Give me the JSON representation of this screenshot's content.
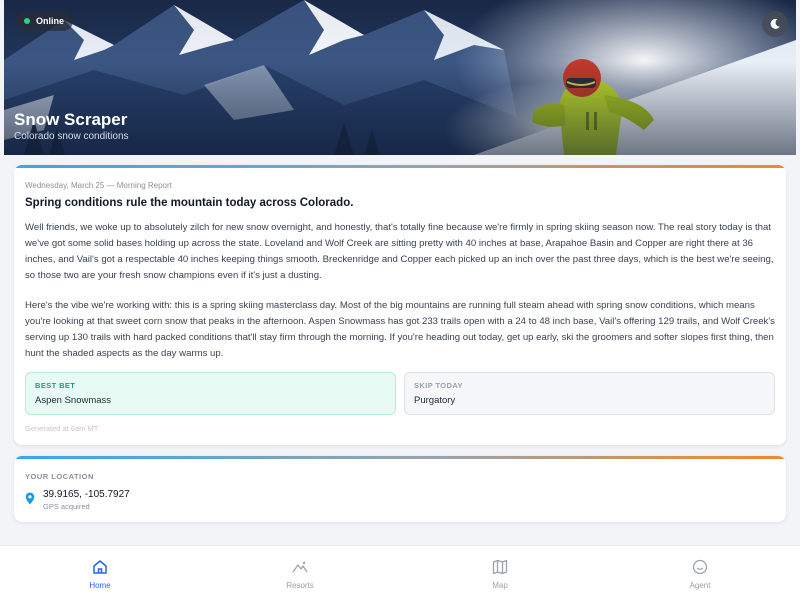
{
  "hero": {
    "status": "Online",
    "title": "Snow Scraper",
    "subtitle": "Colorado snow conditions"
  },
  "report": {
    "date": "Wednesday, March 25 — Morning Report",
    "headline": "Spring conditions rule the mountain today across Colorado.",
    "paragraphs": [
      "Well friends, we woke up to absolutely zilch for new snow overnight, and honestly, that's totally fine because we're firmly in spring skiing season now. The real story today is that we've got some solid bases holding up across the state. Loveland and Wolf Creek are sitting pretty with 40 inches at base, Arapahoe Basin and Copper are right there at 36 inches, and Vail's got a respectable 40 inches keeping things smooth. Breckenridge and Copper each picked up an inch over the past three days, which is the best we're seeing, so those two are your fresh snow champions even if it's just a dusting.",
      "Here's the vibe we're working with: this is a spring skiing masterclass day. Most of the big mountains are running full steam ahead with spring snow conditions, which means you're looking at that sweet corn snow that peaks in the afternoon. Aspen Snowmass has got 233 trails open with a 24 to 48 inch base, Vail's offering 129 trails, and Wolf Creek's serving up 130 trails with hard packed conditions that'll stay firm through the morning. If you're heading out today, get up early, ski the groomers and softer slopes first thing, then hunt the shaded aspects as the day warms up."
    ],
    "best_bet_label": "BEST BET",
    "best_bet_value": "Aspen Snowmass",
    "skip_label": "SKIP TODAY",
    "skip_value": "Purgatory",
    "generated": "Generated at 6am MT"
  },
  "location": {
    "label": "YOUR LOCATION",
    "coords": "39.9165, -105.7927",
    "status": "GPS acquired"
  },
  "tabs": [
    {
      "label": "Home",
      "icon": "home-icon",
      "active": true
    },
    {
      "label": "Resorts",
      "icon": "mountain-icon",
      "active": false
    },
    {
      "label": "Map",
      "icon": "map-icon",
      "active": false
    },
    {
      "label": "Agent",
      "icon": "smiley-icon",
      "active": false
    }
  ],
  "colors": {
    "accent_blue": "#2563eb",
    "online_green": "#2fd27a",
    "best_bet_green": "#16a37a",
    "pin_blue": "#1e9be0",
    "accent_gradient_start": "#3aa7e6",
    "accent_gradient_end": "#f08a24"
  }
}
